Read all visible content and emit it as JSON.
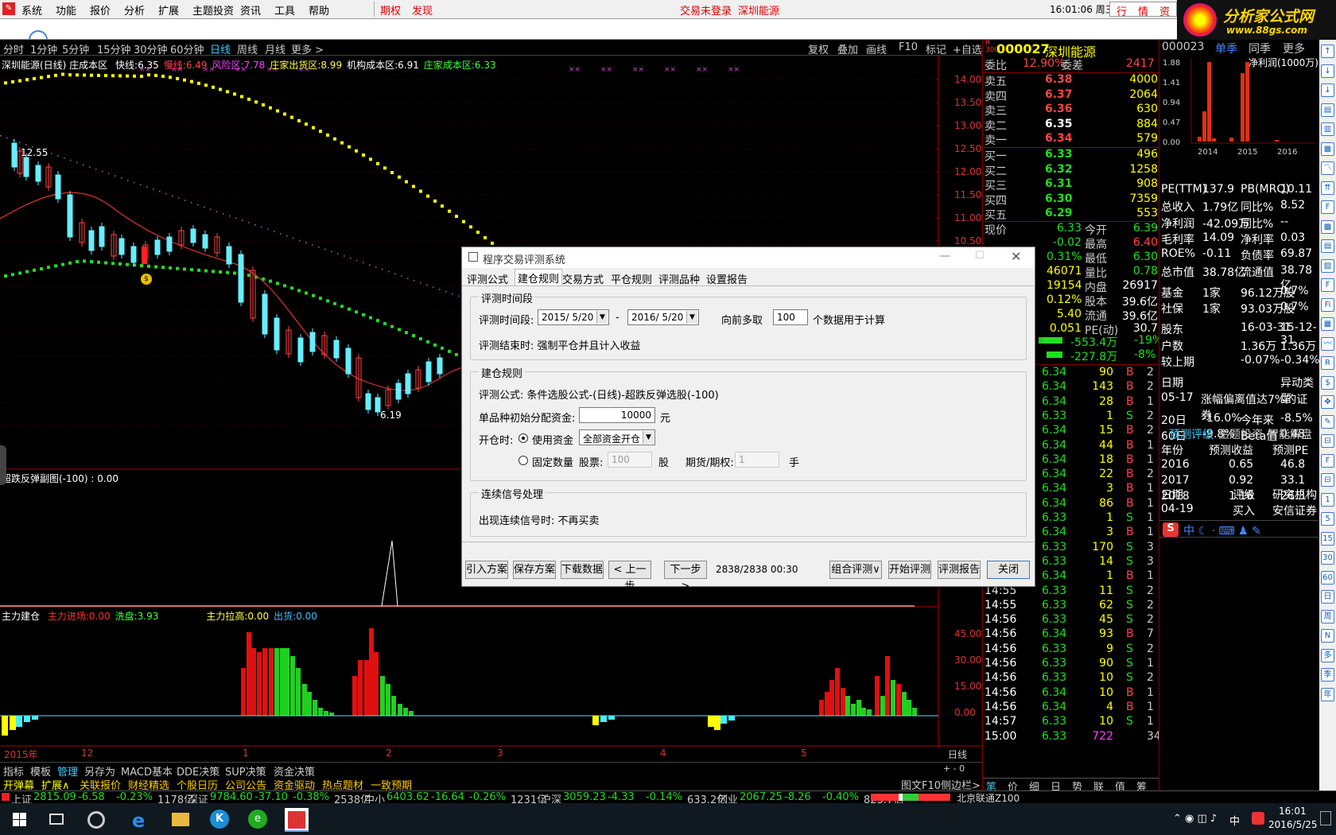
{
  "menubar": {
    "items": [
      "系统",
      "功能",
      "报价",
      "分析",
      "扩展",
      "主题投资",
      "资讯",
      "工具",
      "帮助"
    ],
    "highlight": [
      "期权",
      "发现"
    ],
    "login": "交易未登录",
    "stock": "深圳能源",
    "time": "16:01:06 周三",
    "quick_btns": [
      "行",
      "情",
      "资"
    ]
  },
  "logo": {
    "name": "分析家公式网",
    "url": "www.88gs.com"
  },
  "periods": [
    "分时",
    "1分钟",
    "5分钟",
    "15分钟",
    "30分钟",
    "60分钟",
    "日线",
    "周线",
    "月线",
    "更多 >"
  ],
  "chart_buttons": [
    "复权",
    "叠加",
    "画线",
    "F10",
    "标记",
    "+自选"
  ],
  "main_indicator": {
    "name": "深圳能源(日线) 庄成本区",
    "items": [
      {
        "label": "快线:",
        "value": "6.35",
        "color": "#ffffff"
      },
      {
        "label": "慢线:",
        "value": "6.49",
        "color": "#ff4040"
      },
      {
        "label": "风险区:",
        "value": "7.78",
        "color": "#ff40ff"
      },
      {
        "label": "庄家出货区:",
        "value": "8.99",
        "color": "#ffff40"
      },
      {
        "label": "机构成本区:",
        "value": "6.91",
        "color": "#ffffff"
      },
      {
        "label": "庄家成本区:",
        "value": "6.33",
        "color": "#40ff40"
      }
    ],
    "high_label": "12.55",
    "low_label": "6.19"
  },
  "price_axis": [
    "14.00",
    "13.50",
    "13.00",
    "12.50",
    "12.00",
    "11.50",
    "11.00",
    "10.50"
  ],
  "sub1": {
    "title": "超跌反弹副图(-100) : 0.00"
  },
  "sub2": {
    "title": "主力建仓",
    "items": [
      {
        "label": "主力进场:",
        "value": "0.00",
        "color": "#ff3030"
      },
      {
        "label": "洗盘:",
        "value": "3.93",
        "color": "#40ff40"
      },
      {
        "label": "主力拉高:",
        "value": "0.00",
        "color": "#ffff40"
      },
      {
        "label": "出货:",
        "value": "0.00",
        "color": "#40c0ff"
      }
    ],
    "axis": [
      "45.00",
      "30.00",
      "15.00",
      "0.00"
    ]
  },
  "date_axis": [
    "2015年",
    "12",
    "1",
    "2",
    "3",
    "4",
    "5"
  ],
  "date_axis_right": "日线",
  "bottom_tabs1": [
    "指标",
    "模板",
    "管理",
    "另存为",
    "MACD基本",
    "DDE决策",
    "SUP决策",
    "资金决策"
  ],
  "bottom_tabs2": [
    "开弹幕",
    "扩展∧",
    "关联报价",
    "财经精选",
    "个股日历",
    "公司公告",
    "资金驱动",
    "热点题材",
    "一致预期"
  ],
  "bottom_right": [
    "图文F10",
    "侧边栏>"
  ],
  "quote": {
    "code": "000027",
    "name": "深圳能源",
    "weibi_label": "委比",
    "weibi": "12.90%",
    "weicha_label": "委差",
    "weicha": "2417",
    "sells": [
      {
        "label": "卖五",
        "price": "6.38",
        "vol": "4000"
      },
      {
        "label": "卖四",
        "price": "6.37",
        "vol": "2064"
      },
      {
        "label": "卖三",
        "price": "6.36",
        "vol": "630"
      },
      {
        "label": "卖二",
        "price": "6.35",
        "vol": "884"
      },
      {
        "label": "卖一",
        "price": "6.34",
        "vol": "579"
      }
    ],
    "buys": [
      {
        "label": "买一",
        "price": "6.33",
        "vol": "496"
      },
      {
        "label": "买二",
        "price": "6.32",
        "vol": "1258"
      },
      {
        "label": "买三",
        "price": "6.31",
        "vol": "908"
      },
      {
        "label": "买四",
        "price": "6.30",
        "vol": "7359"
      },
      {
        "label": "买五",
        "price": "6.29",
        "vol": "553"
      }
    ],
    "stats": [
      {
        "a": "现价",
        "b": "6.33",
        "c": "今开",
        "d": "6.39"
      },
      {
        "a": "",
        "b": "-0.02",
        "c": "最高",
        "d": "6.40"
      },
      {
        "a": "",
        "b": "0.31%",
        "c": "最低",
        "d": "6.30"
      },
      {
        "a": "",
        "b": "46071",
        "c": "量比",
        "d": "0.78"
      },
      {
        "a": "",
        "b": "19154",
        "c": "内盘",
        "d": "26917"
      },
      {
        "a": "",
        "b": "0.12%",
        "c": "股本",
        "d": "39.6亿"
      },
      {
        "a": "",
        "b": "5.40",
        "c": "流通",
        "d": "39.6亿"
      },
      {
        "a": "",
        "b": "0.051",
        "c": "PE(动)",
        "d": "30.7"
      }
    ],
    "flow": [
      {
        "v": "-553.4万",
        "p": "-19%"
      },
      {
        "v": "-227.8万",
        "p": "-8%"
      }
    ],
    "ticks": [
      {
        "t": "",
        "p": "6.34",
        "v": "90",
        "s": "B",
        "n": "2"
      },
      {
        "t": "",
        "p": "6.34",
        "v": "143",
        "s": "B",
        "n": "2"
      },
      {
        "t": "",
        "p": "6.34",
        "v": "28",
        "s": "B",
        "n": "1"
      },
      {
        "t": "",
        "p": "6.33",
        "v": "1",
        "s": "S",
        "n": "2"
      },
      {
        "t": "",
        "p": "6.34",
        "v": "15",
        "s": "B",
        "n": "2"
      },
      {
        "t": "",
        "p": "6.34",
        "v": "44",
        "s": "B",
        "n": "1"
      },
      {
        "t": "",
        "p": "6.34",
        "v": "18",
        "s": "B",
        "n": "1"
      },
      {
        "t": "",
        "p": "6.34",
        "v": "22",
        "s": "B",
        "n": "2"
      },
      {
        "t": "",
        "p": "6.34",
        "v": "3",
        "s": "B",
        "n": "1"
      },
      {
        "t": "",
        "p": "6.34",
        "v": "86",
        "s": "B",
        "n": "1"
      },
      {
        "t": "",
        "p": "6.33",
        "v": "1",
        "s": "S",
        "n": "1"
      },
      {
        "t": "",
        "p": "6.34",
        "v": "3",
        "s": "B",
        "n": "1"
      },
      {
        "t": "",
        "p": "6.33",
        "v": "170",
        "s": "S",
        "n": "3"
      },
      {
        "t": "",
        "p": "6.33",
        "v": "14",
        "s": "S",
        "n": "3"
      },
      {
        "t": "14:55",
        "p": "6.34",
        "v": "1",
        "s": "B",
        "n": "1"
      },
      {
        "t": "14:55",
        "p": "6.33",
        "v": "11",
        "s": "S",
        "n": "2"
      },
      {
        "t": "14:55",
        "p": "6.33",
        "v": "62",
        "s": "S",
        "n": "2"
      },
      {
        "t": "14:56",
        "p": "6.33",
        "v": "45",
        "s": "S",
        "n": "2"
      },
      {
        "t": "14:56",
        "p": "6.34",
        "v": "93",
        "s": "B",
        "n": "7"
      },
      {
        "t": "14:56",
        "p": "6.33",
        "v": "9",
        "s": "S",
        "n": "2"
      },
      {
        "t": "14:56",
        "p": "6.33",
        "v": "90",
        "s": "S",
        "n": "1"
      },
      {
        "t": "14:56",
        "p": "6.33",
        "v": "10",
        "s": "S",
        "n": "2"
      },
      {
        "t": "14:56",
        "p": "6.34",
        "v": "10",
        "s": "B",
        "n": "1"
      },
      {
        "t": "14:56",
        "p": "6.34",
        "v": "4",
        "s": "B",
        "n": "1"
      },
      {
        "t": "14:57",
        "p": "6.33",
        "v": "10",
        "s": "S",
        "n": "1"
      },
      {
        "t": "15:00",
        "p": "6.33",
        "v": "722",
        "s": "",
        "n": "34"
      }
    ],
    "tabs": [
      "笔",
      "价",
      "细",
      "日",
      "势",
      "联",
      "值",
      "筹"
    ]
  },
  "fin": {
    "code": "000023",
    "tabs": [
      "单季",
      "同季",
      "更多"
    ],
    "chart_title": "净利润(1000万)",
    "chart_data": {
      "type": "bar",
      "years": [
        "2014",
        "2015",
        "2016"
      ],
      "ylabels": [
        "1.88",
        "1.41",
        "0.94",
        "0.47",
        "0.00"
      ]
    },
    "rows": [
      {
        "a": "PE(TTM)",
        "b": "137.9",
        "c": "PB(MRQ)",
        "d": "10.11"
      },
      {
        "a": "总收入",
        "b": "1.79亿",
        "c": "同比%",
        "d": "8.52"
      },
      {
        "a": "净利润",
        "b": "-42.09万",
        "c": "同比%",
        "d": "--"
      },
      {
        "a": "毛利率",
        "b": "14.09",
        "c": "净利率",
        "d": "0.03"
      },
      {
        "a": "ROE%",
        "b": "-0.11",
        "c": "负债率",
        "d": "69.87"
      },
      {
        "a": "总市值",
        "b": "38.78亿",
        "c": "流通值",
        "d": "38.78亿"
      },
      {
        "a": "基金",
        "b": "1家",
        "c": "96.12万股",
        "d": "0.7%"
      },
      {
        "a": "社保",
        "b": "1家",
        "c": "93.03万股",
        "d": "0.7%"
      },
      {
        "a": "股东",
        "b": "",
        "c": "16-03-31",
        "d": "15-12-31"
      },
      {
        "a": "户数",
        "b": "",
        "c": "1.36万",
        "d": "1.36万"
      },
      {
        "a": "较上期",
        "b": "",
        "c": "-0.07%",
        "d": "-0.34%"
      },
      {
        "a": "日期",
        "b": "",
        "c": "",
        "d": "异动类型"
      },
      {
        "a": "05-17",
        "b": "涨幅偏离值达7%的证券",
        "c": "",
        "d": ""
      },
      {
        "a": "20日",
        "b": "-16.0%",
        "c": "今年来",
        "d": "-8.5%"
      },
      {
        "a": "60日",
        "b": "-9.8%",
        "c": "Beta值",
        "d": "0.48"
      }
    ],
    "pred_tabs": [
      "预测评级",
      "主题投资",
      "智能解盘"
    ],
    "pred_head": [
      "年份",
      "预测收益",
      "预测PE"
    ],
    "pred": [
      [
        "2016",
        "0.65",
        "46.8"
      ],
      [
        "2017",
        "0.92",
        "33.1"
      ],
      [
        "2018",
        "1.16",
        "26.3"
      ]
    ],
    "rating_head": [
      "日期",
      "评级",
      "研究机构"
    ],
    "rating": [
      "04-19",
      "买入",
      "安信证券"
    ]
  },
  "dialog": {
    "title": "程序交易评测系统",
    "tabs": [
      "评测公式",
      "建仓规则",
      "交易方式",
      "平仓规则",
      "评测品种",
      "设置报告"
    ],
    "g1": "评测时间段",
    "period_label": "评测时间段:",
    "date_from": "2015/ 5/20",
    "date_to": "2016/ 5/20",
    "dash": "-",
    "fetch_label": "向前多取",
    "fetch_value": "100",
    "fetch_suffix": "个数据用于计算",
    "end_text": "评测结束时:  强制平仓并且计入收益",
    "g2": "建仓规则",
    "formula_text": "评测公式:    条件选股公式-(日线)-超跌反弹选股(-100)",
    "fund_label": "单品种初始分配资金:",
    "fund_value": "10000",
    "fund_unit": "元",
    "open_label": "开仓时:",
    "use_fund": "使用资金",
    "use_fund_sel": "全部资金开仓",
    "fixed": "固定数量",
    "stock_label": "股票:",
    "stock_value": "100",
    "stock_unit": "股",
    "fut_label": "期货/期权:",
    "fut_value": "1",
    "fut_unit": "手",
    "g3": "连续信号处理",
    "signal_text": "出现连续信号时:  不再买卖",
    "buttons": [
      "引入方案",
      "保存方案",
      "下载数据",
      "< 上一步",
      "下一步 >"
    ],
    "progress": "2838/2838  00:30",
    "buttons2": [
      "组合评测∨",
      "开始评测",
      "评测报告",
      "关闭"
    ]
  },
  "status": {
    "items": [
      {
        "n": "上证",
        "v": "2815.09",
        "c": "-6.58",
        "p": "-0.23%",
        "a": "1178亿"
      },
      {
        "n": "深证",
        "v": "9784.60",
        "c": "-37.10",
        "p": "-0.38%",
        "a": "2538亿"
      },
      {
        "n": "中小",
        "v": "6403.62",
        "c": "-16.64",
        "p": "-0.26%",
        "a": "1231亿"
      },
      {
        "n": "沪深",
        "v": "3059.23",
        "c": "-4.33",
        "p": "-0.14%",
        "a": "633.2亿"
      },
      {
        "n": "创业",
        "v": "2067.25",
        "c": "-8.26",
        "p": "-0.40%",
        "a": "823.7亿"
      }
    ],
    "server": "北京联通Z100"
  },
  "taskbar": {
    "time": "16:01",
    "date": "2016/5/25",
    "ime": "中"
  }
}
